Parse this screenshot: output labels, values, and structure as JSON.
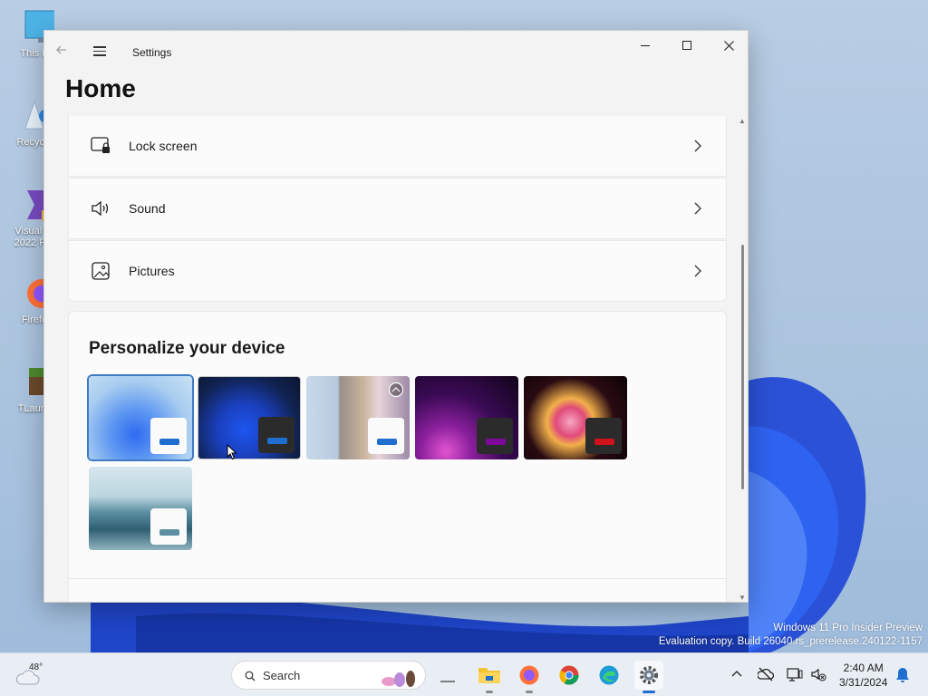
{
  "desktop": {
    "icons": [
      {
        "label": "This P",
        "icon": "monitor-icon"
      },
      {
        "label": "Recycle",
        "icon": "recycle-bin-icon"
      },
      {
        "label": "Visual St 2022 Pre",
        "icon": "visual-studio-icon"
      },
      {
        "label": "Firefo",
        "icon": "firefox-icon"
      },
      {
        "label": "TLaunc",
        "icon": "tlauncher-icon"
      }
    ],
    "watermark": {
      "line1": "Windows 11 Pro Insider Preview",
      "line2": "Evaluation copy. Build 26040.rs_prerelease.240122-1157"
    }
  },
  "window": {
    "app_title": "Settings",
    "page_title": "Home",
    "rows": [
      {
        "label": "Lock screen",
        "icon": "lock-screen-icon"
      },
      {
        "label": "Sound",
        "icon": "speaker-icon"
      },
      {
        "label": "Pictures",
        "icon": "picture-icon"
      }
    ],
    "personalize": {
      "heading": "Personalize your device",
      "themes": [
        {
          "name": "windows-light",
          "accent": "#1f6fd1",
          "selected": true
        },
        {
          "name": "windows-dark",
          "accent": "#1f6fd1",
          "selected": false
        },
        {
          "name": "windows-spotlight",
          "accent": "#1f6fd1",
          "selected": false
        },
        {
          "name": "glow",
          "accent": "#7b0a9b",
          "selected": false
        },
        {
          "name": "captured-motion",
          "accent": "#d0121b",
          "selected": false
        },
        {
          "name": "flow",
          "accent": "#5b8ea0",
          "selected": false
        }
      ]
    }
  },
  "taskbar": {
    "weather_temp": "48°",
    "search_placeholder": "Search",
    "apps": [
      "task-view-icon",
      "file-explorer-icon",
      "firefox-icon",
      "chrome-icon",
      "edge-icon",
      "settings-icon"
    ],
    "clock_time": "2:40 AM",
    "clock_date": "3/31/2024"
  },
  "colors": {
    "accent": "#3f7bc4",
    "window_bg": "#f3f3f3",
    "card_bg": "#fbfbfb"
  }
}
